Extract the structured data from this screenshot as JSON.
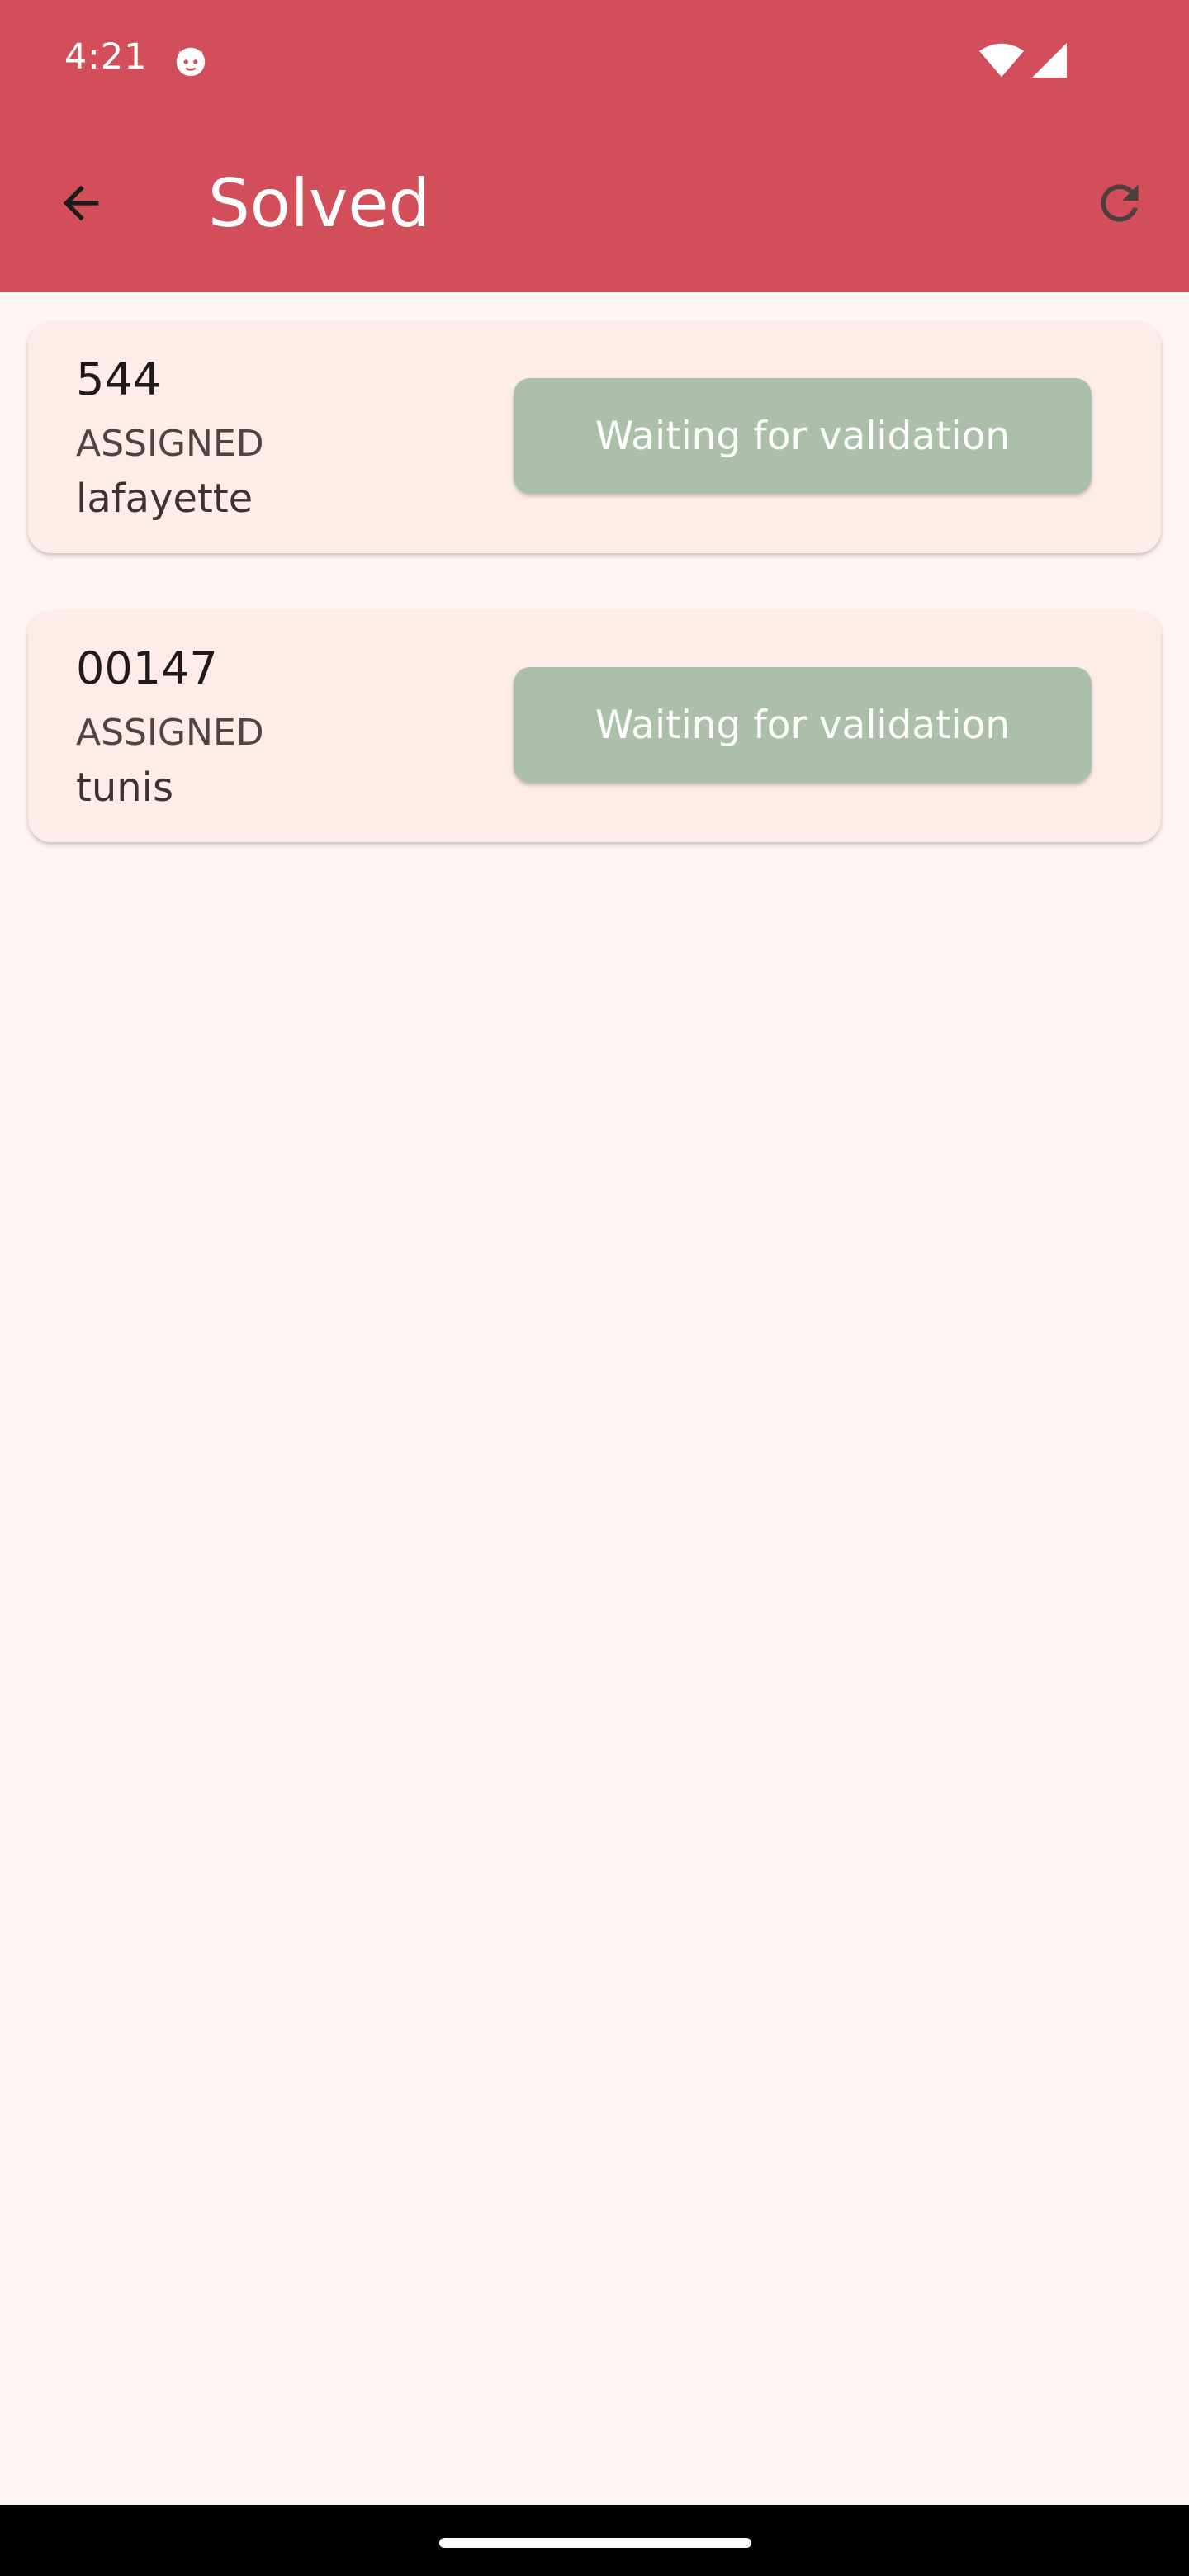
{
  "status_bar": {
    "time": "4:21",
    "notification_icon": "cat-face-icon",
    "wifi_icon": "wifi-icon",
    "signal_icon": "cell-signal-icon"
  },
  "app_bar": {
    "title": "Solved",
    "back_icon": "arrow-back-icon",
    "refresh_icon": "refresh-icon",
    "color": "#d24e5b"
  },
  "tickets": [
    {
      "id": "544",
      "status": "ASSIGNED",
      "location": "lafayette",
      "action_label": "Waiting for validation"
    },
    {
      "id": "00147",
      "status": "ASSIGNED",
      "location": "tunis",
      "action_label": "Waiting for validation"
    }
  ],
  "colors": {
    "background": "#fff5f3",
    "card": "#fdecea",
    "button": "#abbfab"
  }
}
